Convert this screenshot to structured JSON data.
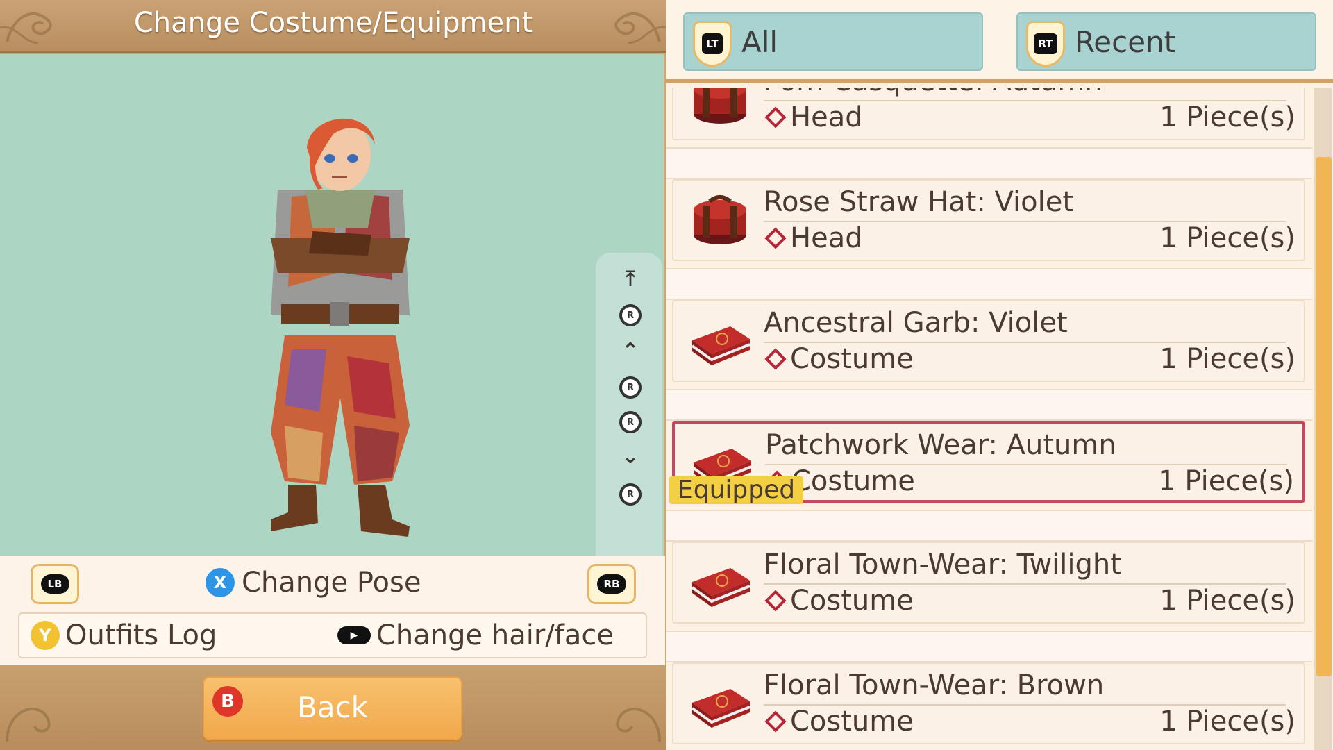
{
  "header": {
    "title": "Change Costume/Equipment"
  },
  "preview": {
    "camera_controls": [
      {
        "name": "top-arrow-icon"
      },
      {
        "name": "r-stick-up-icon",
        "label": "R"
      },
      {
        "name": "zoom-in-arrows-icon"
      },
      {
        "name": "r-stick-left-icon",
        "label": "R"
      },
      {
        "name": "r-stick-right-icon",
        "label": "R"
      },
      {
        "name": "zoom-out-arrows-icon"
      },
      {
        "name": "r-stick-down-icon",
        "label": "R"
      },
      {
        "name": "bottom-arrow-icon"
      }
    ]
  },
  "controls": {
    "lb": "LB",
    "rb": "RB",
    "pose_button": "X",
    "pose_label": "Change Pose",
    "outfits_button": "Y",
    "outfits_label": "Outfits Log",
    "hairface_label": "Change hair/face"
  },
  "back": {
    "button": "B",
    "label": "Back"
  },
  "tabs": [
    {
      "badge": "LT",
      "label": "All"
    },
    {
      "badge": "RT",
      "label": "Recent"
    }
  ],
  "equipped_label": "Equipped",
  "items": [
    {
      "name": "Pom Casquette: Autumn",
      "type": "Head",
      "qty": "1 Piece(s)",
      "icon": "hatbox-icon"
    },
    {
      "name": "Rose Straw Hat: Violet",
      "type": "Head",
      "qty": "1 Piece(s)",
      "icon": "hatbox-icon"
    },
    {
      "name": "Ancestral Garb: Violet",
      "type": "Costume",
      "qty": "1 Piece(s)",
      "icon": "suitcase-icon"
    },
    {
      "name": "Patchwork Wear: Autumn",
      "type": "Costume",
      "qty": "1 Piece(s)",
      "icon": "suitcase-icon"
    },
    {
      "name": "Floral Town-Wear: Twilight",
      "type": "Costume",
      "qty": "1 Piece(s)",
      "icon": "suitcase-icon"
    },
    {
      "name": "Floral Town-Wear: Brown",
      "type": "Costume",
      "qty": "1 Piece(s)",
      "icon": "suitcase-icon"
    }
  ],
  "colors": {
    "preview_bg": "#acd5c4",
    "tab_bg": "#a9d3d1",
    "accent_orange": "#f1a94b",
    "selection_border": "#c14a63",
    "equipped_badge": "#f3cf43"
  }
}
